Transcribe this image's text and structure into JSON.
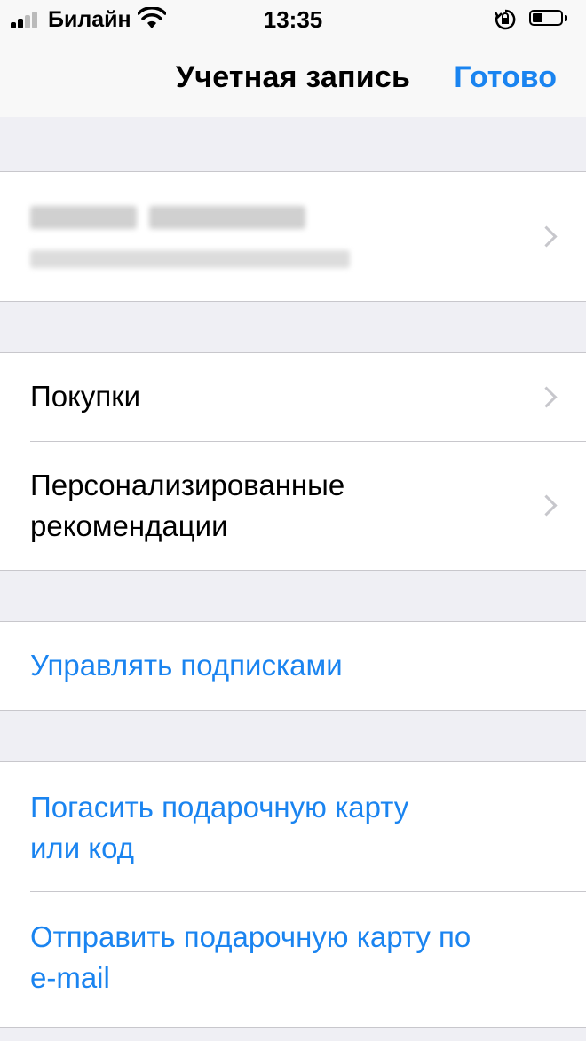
{
  "status_bar": {
    "carrier": "Билайн",
    "time": "13:35"
  },
  "nav": {
    "title": "Учетная запись",
    "done": "Готово"
  },
  "account": {
    "name": "",
    "email": ""
  },
  "menu": {
    "purchases": "Покупки",
    "personalized_line1": "Персонализированные",
    "personalized_line2": "рекомендации",
    "manage_subscriptions": "Управлять подписками",
    "redeem_line1": "Погасить подарочную карту",
    "redeem_line2": "или код",
    "send_line1": "Отправить подарочную карту по",
    "send_line2": "e-mail"
  },
  "colors": {
    "accent": "#1a84f0",
    "background": "#efeff4",
    "separator": "#c8c7cc"
  }
}
